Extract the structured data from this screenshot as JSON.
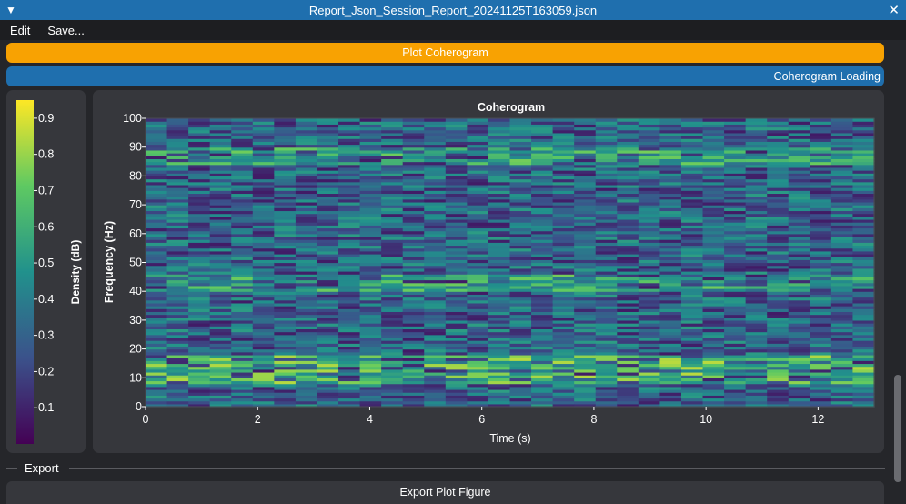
{
  "window": {
    "title": "Report_Json_Session_Report_20241125T163059.json"
  },
  "menu": {
    "edit": "Edit",
    "save": "Save..."
  },
  "buttons": {
    "plot": "Plot Coherogram",
    "loading": "Coherogram Loading",
    "export_figure": "Export Plot Figure"
  },
  "sections": {
    "export": "Export"
  },
  "icons": {
    "collapse": "▼",
    "close": "✕"
  },
  "colors": {
    "accent_orange": "#f8a202",
    "accent_blue": "#1f6fae",
    "colormap": [
      "#440154",
      "#3b528b",
      "#21918c",
      "#5ec962",
      "#fde725"
    ]
  },
  "chart_data": {
    "type": "heatmap",
    "title": "Coherogram",
    "xlabel": "Time (s)",
    "ylabel": "Frequency (Hz)",
    "xlim": [
      0,
      13
    ],
    "ylim": [
      0,
      100
    ],
    "xticks": [
      0,
      2,
      4,
      6,
      8,
      10,
      12
    ],
    "yticks": [
      0,
      10,
      20,
      30,
      40,
      50,
      60,
      70,
      80,
      90,
      100
    ],
    "colorbar": {
      "label": "Density (dB)",
      "range": [
        0,
        0.95
      ],
      "ticks": [
        0.1,
        0.2,
        0.3,
        0.4,
        0.5,
        0.6,
        0.7,
        0.8,
        0.9
      ]
    },
    "colormap": "viridis",
    "grid": false,
    "structure": {
      "time_bins": 34,
      "freq_bins": 100,
      "bands": [
        {
          "freq_range_hz": [
            8,
            18
          ],
          "level": 0.65
        },
        {
          "freq_range_hz": [
            40,
            46
          ],
          "level": 0.55
        },
        {
          "freq_range_hz": [
            84,
            90
          ],
          "level": 0.55
        }
      ],
      "baseline_level": 0.3
    }
  }
}
